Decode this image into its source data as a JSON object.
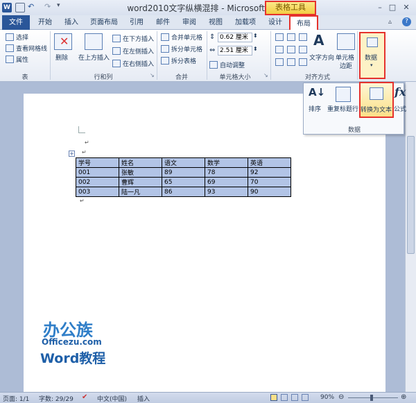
{
  "window": {
    "title": "word2010文字纵横混排 - Microsoft Word",
    "contextual_tab": "表格工具",
    "controls": [
      "–",
      "□",
      "✕"
    ]
  },
  "tabs": [
    "文件",
    "开始",
    "插入",
    "页面布局",
    "引用",
    "邮件",
    "审阅",
    "视图",
    "加载项",
    "设计",
    "布局"
  ],
  "ribbon": {
    "table_group": {
      "label": "表",
      "select": "选择",
      "gridlines": "查看网格线",
      "properties": "属性"
    },
    "rows_cols_group": {
      "label": "行和列",
      "delete": "删除",
      "insert_above": "在上方插入",
      "insert_below": "在下方插入",
      "insert_left": "在左侧插入",
      "insert_right": "在右侧插入"
    },
    "merge_group": {
      "label": "合并",
      "merge_cells": "合并单元格",
      "split_cells": "拆分单元格",
      "split_table": "拆分表格"
    },
    "cell_size_group": {
      "label": "单元格大小",
      "height": "0.62 厘米",
      "width": "2.51 厘米",
      "autofit": "自动调整"
    },
    "align_group": {
      "label": "对齐方式",
      "text_direction": "文字方向",
      "cell_margins_1": "单元格",
      "cell_margins_2": "边距"
    },
    "data_button": "数据"
  },
  "data_panel": {
    "sort": "排序",
    "repeat_header": "重复标题行",
    "convert_to_text": "转换为文本",
    "formula": "公式",
    "label": "数据"
  },
  "table": {
    "rows": [
      [
        "学号",
        "姓名",
        "语文",
        "数学",
        "英语"
      ],
      [
        "001",
        "张敏",
        "89",
        "78",
        "92"
      ],
      [
        "002",
        "曹辉",
        "65",
        "69",
        "70"
      ],
      [
        "003",
        "陆一凡",
        "86",
        "93",
        "90"
      ]
    ]
  },
  "watermark": {
    "brand": "办公族",
    "url": "Officezu.com",
    "course": "Word教程"
  },
  "status": {
    "page": "页面: 1/1",
    "words": "字数: 29/29",
    "language": "中文(中国)",
    "mode": "插入",
    "zoom": "90%"
  }
}
